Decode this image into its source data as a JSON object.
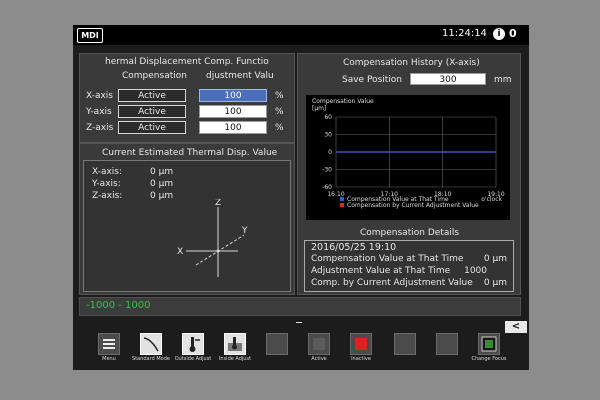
{
  "topbar": {
    "mode": "MDI",
    "time": "11:24:14",
    "info_icon": "i",
    "counter": "0"
  },
  "comp_function": {
    "title": "hermal Displacement Comp. Functio",
    "col_compensation": "Compensation",
    "col_adjustment": "djustment Valu",
    "rows": [
      {
        "axis": "X-axis",
        "status": "Active",
        "value": "100",
        "unit": "%"
      },
      {
        "axis": "Y-axis",
        "status": "Active",
        "value": "100",
        "unit": "%"
      },
      {
        "axis": "Z-axis",
        "status": "Active",
        "value": "100",
        "unit": "%"
      }
    ]
  },
  "current_estimated": {
    "title": "Current Estimated Thermal Disp. Value",
    "rows": [
      {
        "axis": "X-axis:",
        "value": "0 μm"
      },
      {
        "axis": "Y-axis:",
        "value": "0 μm"
      },
      {
        "axis": "Z-axis:",
        "value": "0 μm"
      }
    ],
    "diagram_labels": {
      "z": "Z",
      "y": "Y",
      "x": "X"
    }
  },
  "history": {
    "title": "Compensation History (X-axis)",
    "save_position_label": "Save Position",
    "save_position_value": "300",
    "save_position_unit": "mm"
  },
  "chart_data": {
    "type": "line",
    "title": "Compensation Value",
    "ylabel": "[μm]",
    "xlabel": "o'clock",
    "ylim": [
      -60,
      60
    ],
    "y_ticks": [
      "60",
      "30",
      "0",
      "-30",
      "-60"
    ],
    "x_ticks": [
      "16:10",
      "17:10",
      "18:10",
      "19:10"
    ],
    "x": [
      "16:10",
      "17:10",
      "18:10",
      "19:10"
    ],
    "series": [
      {
        "name": "Compensation Value at That Time",
        "values": [
          0,
          0,
          0,
          0
        ],
        "color": "#3b5bd6"
      },
      {
        "name": "Compensation by Current Adjustment Value",
        "values": [
          0,
          0,
          0,
          0
        ],
        "color": "#d62b2b"
      }
    ]
  },
  "details": {
    "title": "Compensation Details",
    "date": "2016/05/25 19:10",
    "rows": [
      {
        "label": "Compensation Value at That Time",
        "value": "0 μm"
      },
      {
        "label": "Adjustment Value at That Time",
        "value": "1000"
      },
      {
        "label": "Comp. by Current Adjustment Value",
        "value": "0 μm"
      }
    ]
  },
  "statusbar": {
    "range": "-1000 - 1000"
  },
  "softkeys": [
    {
      "label": "Menu",
      "icon": "menu-icon"
    },
    {
      "label": "Standard Mode",
      "icon": "curve-icon"
    },
    {
      "label": "Outside Adjust",
      "icon": "thermometer-icon"
    },
    {
      "label": "Inside Adjust",
      "icon": "thermometer-icon"
    },
    {
      "label": "",
      "icon": ""
    },
    {
      "label": "Active",
      "icon": ""
    },
    {
      "label": "Inactive",
      "icon": "red-square-icon"
    },
    {
      "label": "",
      "icon": ""
    },
    {
      "label": "",
      "icon": ""
    },
    {
      "label": "Change Focus",
      "icon": "focus-icon"
    }
  ],
  "colors": {
    "accent_selected": "#4a6fb8",
    "status_text": "#39c24a",
    "series_blue": "#3b5bd6",
    "series_red": "#d62b2b"
  }
}
